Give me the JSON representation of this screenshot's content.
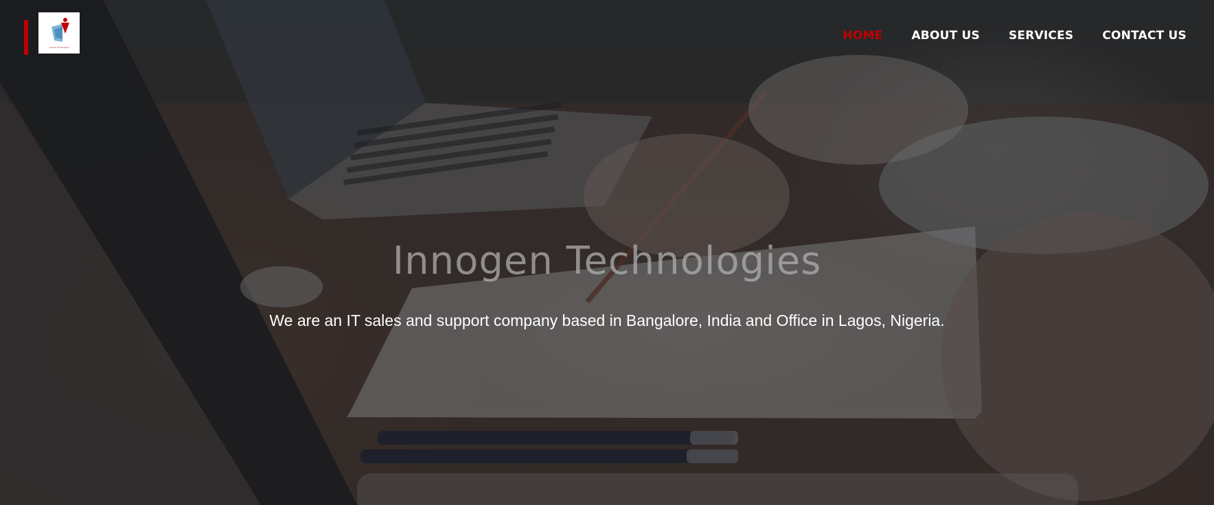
{
  "brand": {
    "logo_text": "Innogen Technologies",
    "accent_color": "#c00000"
  },
  "nav": {
    "items": [
      {
        "label": "HOME",
        "active": true
      },
      {
        "label": "ABOUT US",
        "active": false
      },
      {
        "label": "SERVICES",
        "active": false
      },
      {
        "label": "CONTACT US",
        "active": false
      }
    ]
  },
  "hero": {
    "title": "Innogen Technologies",
    "subtitle": "We are an IT sales and support company based in Bangalore, India and Office in Lagos, Nigeria."
  }
}
